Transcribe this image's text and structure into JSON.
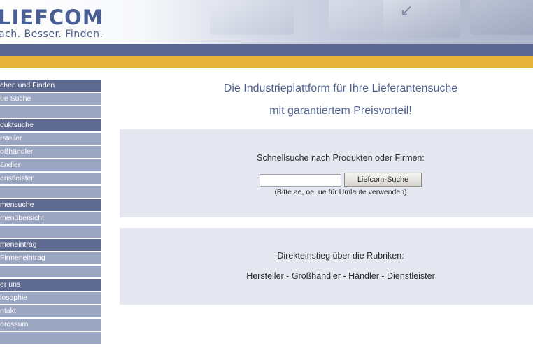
{
  "header": {
    "logo": "LIEFCOM",
    "slogan": "ach. Besser. Finden."
  },
  "sidebar": {
    "items": [
      {
        "label": "chen und Finden",
        "type": "head"
      },
      {
        "label": "ue Suche",
        "type": "link"
      },
      {
        "label": "",
        "type": "blank"
      },
      {
        "label": "duktsuche",
        "type": "head"
      },
      {
        "label": "rsteller",
        "type": "link"
      },
      {
        "label": "oßhändler",
        "type": "link"
      },
      {
        "label": "ändler",
        "type": "link"
      },
      {
        "label": "enstleister",
        "type": "link"
      },
      {
        "label": "",
        "type": "blank"
      },
      {
        "label": "mensuche",
        "type": "head"
      },
      {
        "label": "menübersicht",
        "type": "link"
      },
      {
        "label": "",
        "type": "blank"
      },
      {
        "label": "meneintrag",
        "type": "head"
      },
      {
        "label": "Firmeneintrag",
        "type": "link"
      },
      {
        "label": "",
        "type": "blank"
      },
      {
        "label": "er uns",
        "type": "head"
      },
      {
        "label": "losophie",
        "type": "link"
      },
      {
        "label": "ntakt",
        "type": "link"
      },
      {
        "label": "oressum",
        "type": "link"
      },
      {
        "label": "",
        "type": "blank"
      }
    ]
  },
  "main": {
    "title_line1": "Die Industrieplattform für Ihre Lieferantensuche",
    "title_line2": "mit garantiertem Preisvorteil!",
    "quick_search": {
      "label": "Schnellsuche nach Produkten oder Firmen:",
      "input_value": "",
      "button_label": "Liefcom-Suche",
      "hint": "(Bitte ae, oe, ue für Umlaute verwenden)"
    },
    "direct": {
      "label": "Direkteinstieg über die Rubriken:",
      "links": [
        "Hersteller",
        "Großhändler",
        "Händler",
        "Dienstleister"
      ],
      "separator": " - "
    }
  },
  "colors": {
    "header_blue_bar": "#5a6792",
    "header_yellow_bar": "#e7b23a",
    "nav_head": "#5e6a8f",
    "nav_item": "#9ba6c2",
    "title_text": "#4f5f8f",
    "panel_bg": "#e5e8f0"
  }
}
